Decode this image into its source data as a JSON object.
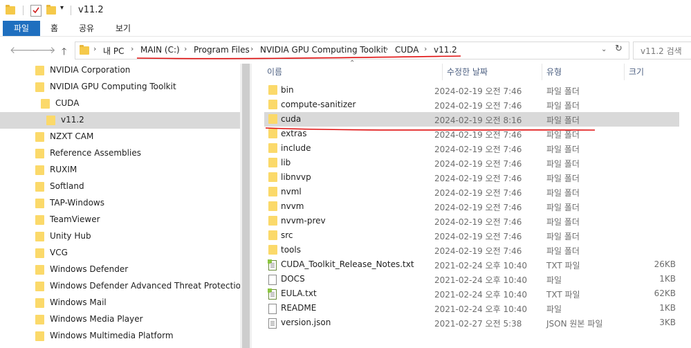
{
  "window": {
    "title": "v11.2",
    "quick_access": [
      "folder-icon",
      "properties-check-icon",
      "new-folder-icon",
      "customize-dropdown-icon"
    ]
  },
  "ribbon": {
    "tabs": [
      "파일",
      "홈",
      "공유",
      "보기"
    ]
  },
  "address_bar": {
    "breadcrumbs": [
      "내 PC",
      "MAIN (C:)",
      "Program Files",
      "NVIDIA GPU Computing Toolkit",
      "CUDA",
      "v11.2"
    ],
    "search_placeholder": "v11.2 검색"
  },
  "nav_pane": {
    "items": [
      {
        "label": "NVIDIA Corporation",
        "level": 0,
        "selected": false
      },
      {
        "label": "NVIDIA GPU Computing Toolkit",
        "level": 0,
        "selected": false
      },
      {
        "label": "CUDA",
        "level": 1,
        "selected": false
      },
      {
        "label": "v11.2",
        "level": 2,
        "selected": true
      },
      {
        "label": "NZXT CAM",
        "level": 0,
        "selected": false
      },
      {
        "label": "Reference Assemblies",
        "level": 0,
        "selected": false
      },
      {
        "label": "RUXIM",
        "level": 0,
        "selected": false
      },
      {
        "label": "Softland",
        "level": 0,
        "selected": false
      },
      {
        "label": "TAP-Windows",
        "level": 0,
        "selected": false
      },
      {
        "label": "TeamViewer",
        "level": 0,
        "selected": false
      },
      {
        "label": "Unity Hub",
        "level": 0,
        "selected": false
      },
      {
        "label": "VCG",
        "level": 0,
        "selected": false
      },
      {
        "label": "Windows Defender",
        "level": 0,
        "selected": false
      },
      {
        "label": "Windows Defender Advanced Threat Protection",
        "level": 0,
        "selected": false
      },
      {
        "label": "Windows Mail",
        "level": 0,
        "selected": false
      },
      {
        "label": "Windows Media Player",
        "level": 0,
        "selected": false
      },
      {
        "label": "Windows Multimedia Platform",
        "level": 0,
        "selected": false
      }
    ]
  },
  "file_list": {
    "columns": [
      "이름",
      "수정한 날짜",
      "유형",
      "크기"
    ],
    "rows": [
      {
        "name": "bin",
        "date": "2024-02-19 오전 7:46",
        "type": "파일 폴더",
        "size": "",
        "icon": "folder-icon",
        "selected": false
      },
      {
        "name": "compute-sanitizer",
        "date": "2024-02-19 오전 7:46",
        "type": "파일 폴더",
        "size": "",
        "icon": "folder-icon",
        "selected": false
      },
      {
        "name": "cuda",
        "date": "2024-02-19 오전 8:16",
        "type": "파일 폴더",
        "size": "",
        "icon": "folder-icon",
        "selected": true
      },
      {
        "name": "extras",
        "date": "2024-02-19 오전 7:46",
        "type": "파일 폴더",
        "size": "",
        "icon": "folder-icon",
        "selected": false
      },
      {
        "name": "include",
        "date": "2024-02-19 오전 7:46",
        "type": "파일 폴더",
        "size": "",
        "icon": "folder-icon",
        "selected": false
      },
      {
        "name": "lib",
        "date": "2024-02-19 오전 7:46",
        "type": "파일 폴더",
        "size": "",
        "icon": "folder-icon",
        "selected": false
      },
      {
        "name": "libnvvp",
        "date": "2024-02-19 오전 7:46",
        "type": "파일 폴더",
        "size": "",
        "icon": "folder-icon",
        "selected": false
      },
      {
        "name": "nvml",
        "date": "2024-02-19 오전 7:46",
        "type": "파일 폴더",
        "size": "",
        "icon": "folder-icon",
        "selected": false
      },
      {
        "name": "nvvm",
        "date": "2024-02-19 오전 7:46",
        "type": "파일 폴더",
        "size": "",
        "icon": "folder-icon",
        "selected": false
      },
      {
        "name": "nvvm-prev",
        "date": "2024-02-19 오전 7:46",
        "type": "파일 폴더",
        "size": "",
        "icon": "folder-icon",
        "selected": false
      },
      {
        "name": "src",
        "date": "2024-02-19 오전 7:46",
        "type": "파일 폴더",
        "size": "",
        "icon": "folder-icon",
        "selected": false
      },
      {
        "name": "tools",
        "date": "2024-02-19 오전 7:46",
        "type": "파일 폴더",
        "size": "",
        "icon": "folder-icon",
        "selected": false
      },
      {
        "name": "CUDA_Toolkit_Release_Notes.txt",
        "date": "2021-02-24 오후 10:40",
        "type": "TXT 파일",
        "size": "26KB",
        "icon": "notepad-file-icon",
        "selected": false
      },
      {
        "name": "DOCS",
        "date": "2021-02-24 오후 10:40",
        "type": "파일",
        "size": "1KB",
        "icon": "blank-file-icon",
        "selected": false
      },
      {
        "name": "EULA.txt",
        "date": "2021-02-24 오후 10:40",
        "type": "TXT 파일",
        "size": "62KB",
        "icon": "notepad-file-icon",
        "selected": false
      },
      {
        "name": "README",
        "date": "2021-02-24 오후 10:40",
        "type": "파일",
        "size": "1KB",
        "icon": "blank-file-icon",
        "selected": false
      },
      {
        "name": "version.json",
        "date": "2021-02-27 오전 5:38",
        "type": "JSON 원본 파일",
        "size": "3KB",
        "icon": "text-file-icon",
        "selected": false
      }
    ]
  },
  "colors": {
    "ribbon_file_tab": "#1f6fbf",
    "selection": "#d9d9d9",
    "annotation": "#e01010",
    "column_header_text": "#4d6082"
  }
}
